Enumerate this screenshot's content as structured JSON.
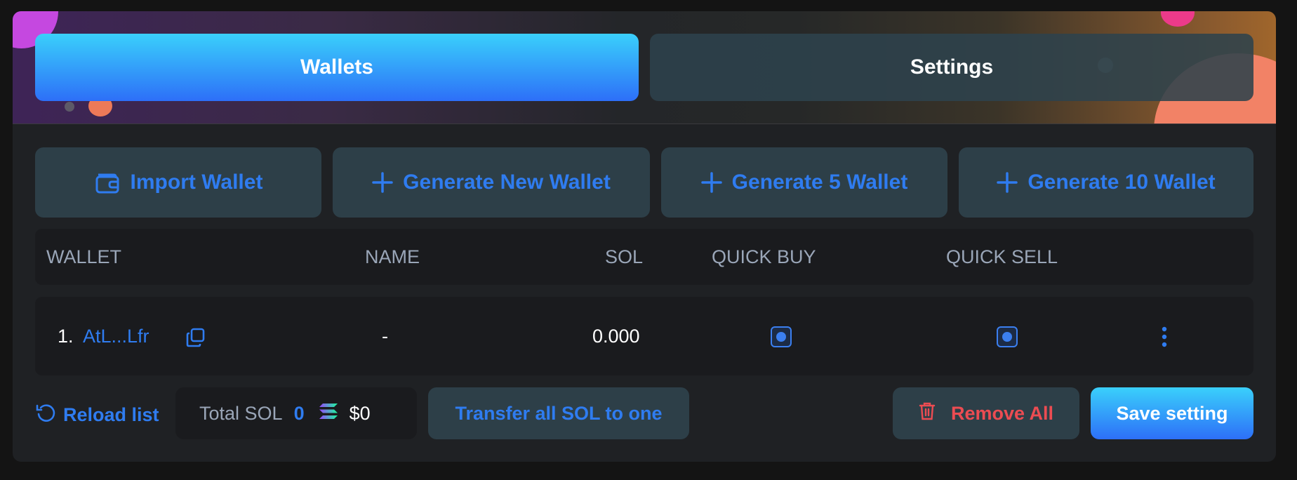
{
  "tabs": {
    "wallets": "Wallets",
    "settings": "Settings"
  },
  "actions": {
    "import": "Import Wallet",
    "generate_new": "Generate New Wallet",
    "generate_5": "Generate 5 Wallet",
    "generate_10": "Generate 10 Wallet"
  },
  "table": {
    "headers": {
      "wallet": "WALLET",
      "name": "NAME",
      "sol": "SOL",
      "quick_buy": "QUICK BUY",
      "quick_sell": "QUICK SELL"
    },
    "rows": [
      {
        "index": "1.",
        "address": "AtL...Lfr",
        "name": "-",
        "sol": "0.000",
        "quick_buy": true,
        "quick_sell": true
      }
    ]
  },
  "footer": {
    "reload": "Reload list",
    "total_label": "Total SOL",
    "total_sol": "0",
    "total_usd": "$0",
    "transfer": "Transfer all SOL to one",
    "remove_all": "Remove All",
    "save": "Save setting"
  },
  "colors": {
    "accent": "#2f7cf0",
    "danger": "#ec4c52",
    "gradient_top": "#3ad0fb",
    "gradient_bottom": "#2d6ff8",
    "panel": "#1f2124",
    "button_bg": "#2d3f48"
  },
  "icons": {
    "import": "wallet-icon",
    "generate": "plus-icon",
    "copy": "copy-icon",
    "more": "more-vertical-icon",
    "reload": "reload-icon",
    "sol": "solana-logo",
    "remove": "trash-icon"
  }
}
